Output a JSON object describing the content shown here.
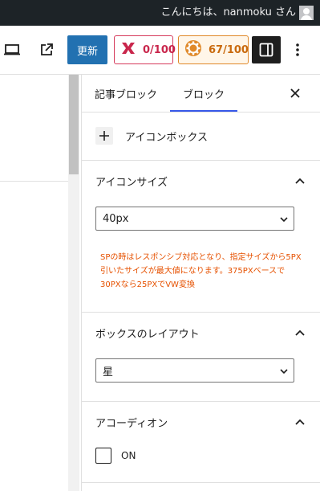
{
  "admin_bar": {
    "greeting": "こんにちは、nanmoku さん"
  },
  "toolbar": {
    "preview_icon": "laptop-icon",
    "external_icon": "external-link-icon",
    "update_label": "更新",
    "score_a": {
      "icon": "seo-score-icon",
      "value": "0/100",
      "color": "#c9264c"
    },
    "score_b": {
      "icon": "gear-score-icon",
      "value": "67/100",
      "color": "#e0892a"
    },
    "sidebar_icon": "sidebar-toggle-icon",
    "more_icon": "more-vertical-icon"
  },
  "inspector": {
    "tabs": [
      {
        "label": "記事ブロック"
      },
      {
        "label": "ブロック"
      }
    ],
    "block_card": {
      "icon": "plus-icon",
      "name": "アイコンボックス"
    },
    "panels": {
      "icon_size": {
        "title": "アイコンサイズ",
        "selected": "40px",
        "note": "SPの時はレスポンシブ対応となり、指定サイズから5PX引いたサイズが最大値になります。375PXベースで30PXなら25PXでVW変換"
      },
      "box_layout": {
        "title": "ボックスのレイアウト",
        "selected": "星"
      },
      "accordion": {
        "title": "アコーディオン",
        "checkbox_label": "ON"
      }
    }
  },
  "colors": {
    "accent": "#3858e9",
    "primary_button": "#2271b1",
    "note_text": "#e65100"
  }
}
